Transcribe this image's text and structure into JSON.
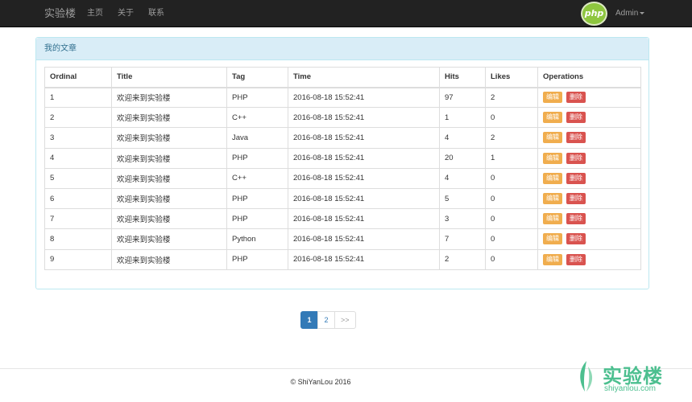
{
  "navbar": {
    "brand": "实验楼",
    "links": [
      "主页",
      "关于",
      "联系"
    ],
    "logo_text": "php",
    "user": "Admin"
  },
  "panel": {
    "title": "我的文章"
  },
  "table": {
    "headers": [
      "Ordinal",
      "Title",
      "Tag",
      "Time",
      "Hits",
      "Likes",
      "Operations"
    ],
    "edit_label": "编辑",
    "delete_label": "删除",
    "rows": [
      [
        "1",
        "欢迎来到实验楼",
        "PHP",
        "2016-08-18 15:52:41",
        "97",
        "2"
      ],
      [
        "2",
        "欢迎来到实验楼",
        "C++",
        "2016-08-18 15:52:41",
        "1",
        "0"
      ],
      [
        "3",
        "欢迎来到实验楼",
        "Java",
        "2016-08-18 15:52:41",
        "4",
        "2"
      ],
      [
        "4",
        "欢迎来到实验楼",
        "PHP",
        "2016-08-18 15:52:41",
        "20",
        "1"
      ],
      [
        "5",
        "欢迎来到实验楼",
        "C++",
        "2016-08-18 15:52:41",
        "4",
        "0"
      ],
      [
        "6",
        "欢迎来到实验楼",
        "PHP",
        "2016-08-18 15:52:41",
        "5",
        "0"
      ],
      [
        "7",
        "欢迎来到实验楼",
        "PHP",
        "2016-08-18 15:52:41",
        "3",
        "0"
      ],
      [
        "8",
        "欢迎来到实验楼",
        "Python",
        "2016-08-18 15:52:41",
        "7",
        "0"
      ],
      [
        "9",
        "欢迎来到实验楼",
        "PHP",
        "2016-08-18 15:52:41",
        "2",
        "0"
      ]
    ]
  },
  "pagination": {
    "pages": [
      "1",
      "2"
    ],
    "next": ">>"
  },
  "footer": {
    "copyright": "© ShiYanLou 2016"
  },
  "watermark": {
    "cn": "实验楼",
    "en": "shiyanlou.com"
  },
  "colors": {
    "navbar": "#222222",
    "panel_heading": "#d9edf7",
    "accent": "#337ab7",
    "edit": "#f0ad4e",
    "delete": "#d9534f",
    "watermark": "#4cbf8f"
  }
}
